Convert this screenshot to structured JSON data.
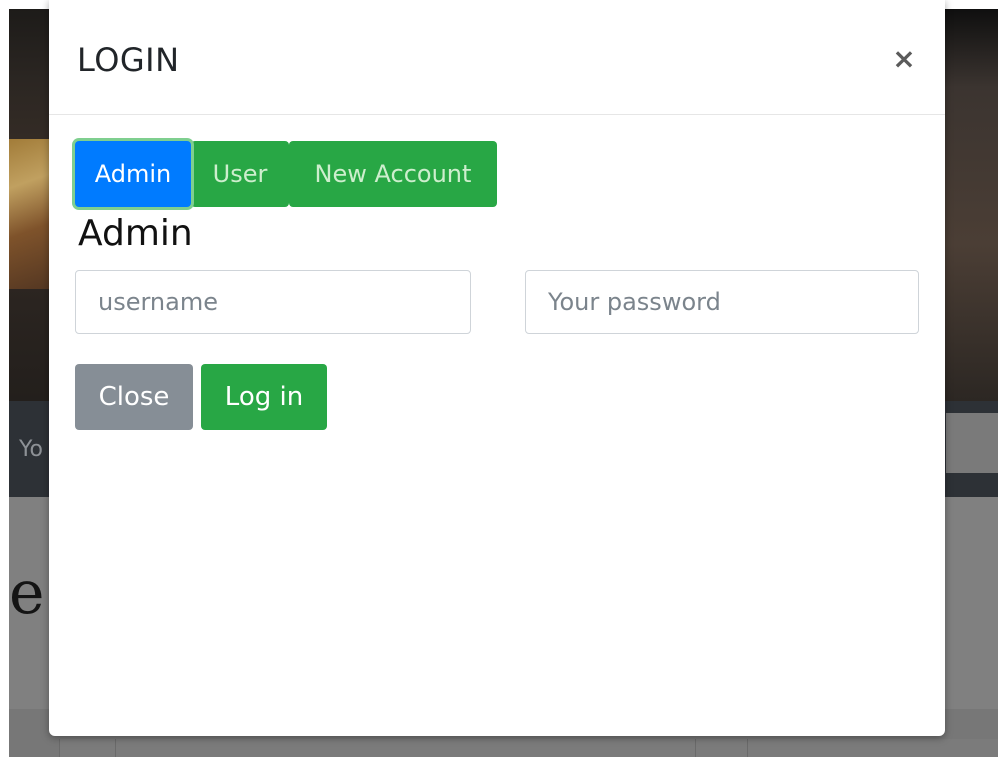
{
  "background": {
    "navbar_partial_text": "Yo",
    "heading_partial_char": "e"
  },
  "modal": {
    "title": "LOGIN",
    "close_icon": "×",
    "tabs": [
      {
        "label": "Admin",
        "active": true
      },
      {
        "label": "User",
        "active": false
      },
      {
        "label": "New Account",
        "active": false
      }
    ],
    "section_title": "Admin",
    "username_placeholder": "username",
    "password_placeholder": "Your password",
    "buttons": {
      "close_label": "Close",
      "login_label": "Log in"
    }
  },
  "colors": {
    "active_tab": "#007bff",
    "tab": "#28a745",
    "close_button": "#868e96",
    "login_button": "#28a745"
  }
}
